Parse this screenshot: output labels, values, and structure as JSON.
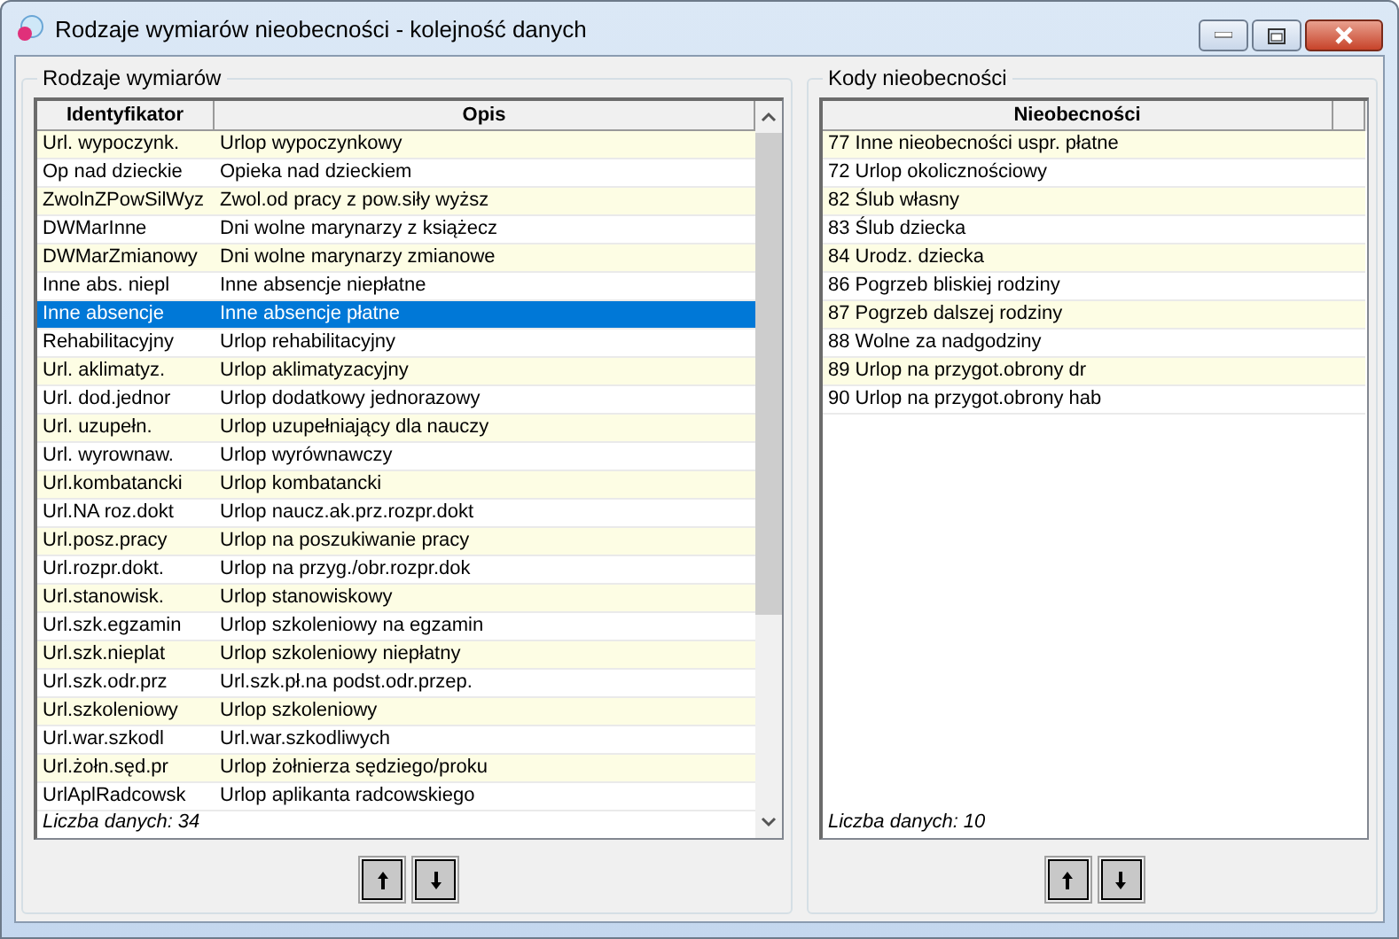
{
  "window": {
    "title": "Rodzaje wymiarów nieobecności  - kolejność danych"
  },
  "left_panel": {
    "legend": "Rodzaje wymiarów",
    "columns": [
      "Identyfikator",
      "Opis"
    ],
    "rows": [
      {
        "id": "Url. wypoczynk.",
        "opis": "Urlop wypoczynkowy",
        "selected": false
      },
      {
        "id": "Op nad dzieckie",
        "opis": "Opieka nad dzieckiem",
        "selected": false
      },
      {
        "id": "ZwolnZPowSilWyz",
        "opis": "Zwol.od pracy z pow.siły wyższ",
        "selected": false
      },
      {
        "id": "DWMarInne",
        "opis": "Dni wolne marynarzy z książecz",
        "selected": false
      },
      {
        "id": "DWMarZmianowy",
        "opis": "Dni wolne marynarzy zmianowe",
        "selected": false
      },
      {
        "id": "Inne abs. niepl",
        "opis": "Inne absencje niepłatne",
        "selected": false
      },
      {
        "id": "Inne absencje",
        "opis": "Inne absencje płatne",
        "selected": true
      },
      {
        "id": "Rehabilitacyjny",
        "opis": "Urlop rehabilitacyjny",
        "selected": false
      },
      {
        "id": "Url. aklimatyz.",
        "opis": "Urlop aklimatyzacyjny",
        "selected": false
      },
      {
        "id": "Url. dod.jednor",
        "opis": "Urlop dodatkowy jednorazowy",
        "selected": false
      },
      {
        "id": "Url. uzupełn.",
        "opis": "Urlop uzupełniający dla nauczy",
        "selected": false
      },
      {
        "id": "Url. wyrownaw.",
        "opis": "Urlop wyrównawczy",
        "selected": false
      },
      {
        "id": "Url.kombatancki",
        "opis": "Urlop kombatancki",
        "selected": false
      },
      {
        "id": "Url.NA roz.dokt",
        "opis": "Urlop naucz.ak.prz.rozpr.dokt",
        "selected": false
      },
      {
        "id": "Url.posz.pracy",
        "opis": "Urlop na poszukiwanie pracy",
        "selected": false
      },
      {
        "id": "Url.rozpr.dokt.",
        "opis": "Urlop na przyg./obr.rozpr.dok",
        "selected": false
      },
      {
        "id": "Url.stanowisk.",
        "opis": "Urlop stanowiskowy",
        "selected": false
      },
      {
        "id": "Url.szk.egzamin",
        "opis": "Urlop szkoleniowy na egzamin",
        "selected": false
      },
      {
        "id": "Url.szk.nieplat",
        "opis": "Urlop szkoleniowy niepłatny",
        "selected": false
      },
      {
        "id": "Url.szk.odr.prz",
        "opis": "Url.szk.pł.na podst.odr.przep.",
        "selected": false
      },
      {
        "id": "Url.szkoleniowy",
        "opis": "Urlop szkoleniowy",
        "selected": false
      },
      {
        "id": "Url.war.szkodl",
        "opis": "Url.war.szkodliwych",
        "selected": false
      },
      {
        "id": "Url.żołn.sęd.pr",
        "opis": "Urlop żołnierza sędziego/proku",
        "selected": false
      },
      {
        "id": "UrlAplRadcowsk",
        "opis": "Urlop aplikanta radcowskiego",
        "selected": false
      }
    ],
    "footer": "Liczba danych: 34"
  },
  "right_panel": {
    "legend": "Kody nieobecności",
    "columns": [
      "Nieobecności"
    ],
    "rows": [
      {
        "text": "77 Inne nieobecności uspr. płatne",
        "selected": false
      },
      {
        "text": "72 Urlop okolicznościowy",
        "selected": false
      },
      {
        "text": "82 Ślub własny",
        "selected": false
      },
      {
        "text": "83 Ślub dziecka",
        "selected": false
      },
      {
        "text": "84 Urodz. dziecka",
        "selected": false
      },
      {
        "text": "86 Pogrzeb bliskiej rodziny",
        "selected": false
      },
      {
        "text": "87 Pogrzeb dalszej rodziny",
        "selected": false
      },
      {
        "text": "88 Wolne za nadgodziny",
        "selected": false
      },
      {
        "text": "89 Urlop na przygot.obrony dr",
        "selected": false
      },
      {
        "text": "90 Urlop na przygot.obrony hab",
        "selected": false
      }
    ],
    "footer": "Liczba danych: 10"
  }
}
